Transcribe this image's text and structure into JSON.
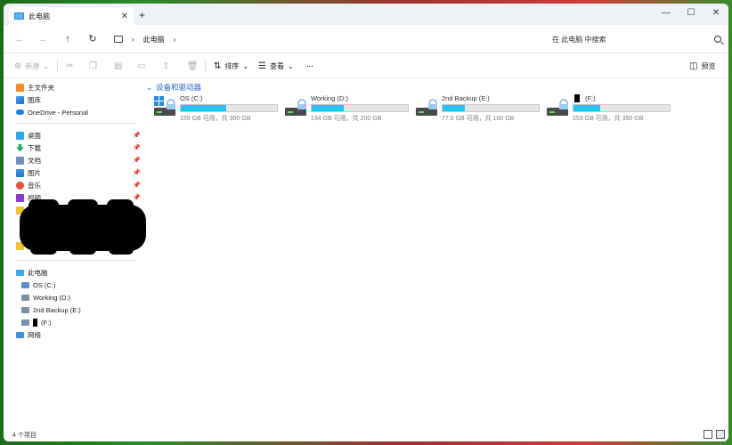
{
  "window": {
    "tab_title": "此电脑",
    "tab_close": "✕",
    "new_tab": "+",
    "minimize": "—",
    "maximize": "☐",
    "close": "✕"
  },
  "address": {
    "back": "←",
    "forward": "→",
    "up": "↑",
    "refresh": "↻",
    "crumb_sep": "›",
    "breadcrumb": [
      "此电脑"
    ],
    "search_placeholder": "在 此电脑 中搜索"
  },
  "toolbar": {
    "new_label": "新建",
    "sort_label": "排序",
    "view_label": "查看",
    "more_label": "···",
    "preview_label": "预览"
  },
  "sidebar": {
    "top_items": [
      {
        "label": "主文件夹",
        "icon": "home-icon"
      },
      {
        "label": "图库",
        "icon": "gallery-icon"
      },
      {
        "label": "OneDrive - Personal",
        "icon": "cloud-icon"
      }
    ],
    "quick_items": [
      {
        "label": "桌面",
        "icon": "desktop-icon"
      },
      {
        "label": "下载",
        "icon": "download-icon"
      },
      {
        "label": "文档",
        "icon": "document-icon"
      },
      {
        "label": "图片",
        "icon": "picture-icon"
      },
      {
        "label": "音乐",
        "icon": "music-icon"
      },
      {
        "label": "视频",
        "icon": "video-icon"
      }
    ],
    "this_pc": "此电脑",
    "drives": [
      "OS (C:)",
      "Working (D:)",
      "2nd Backup (E:)",
      "(F:)"
    ],
    "network": "网络"
  },
  "content": {
    "section_title": "设备和驱动器",
    "drives": [
      {
        "name": "OS (C:)",
        "free_text": "159 GB 可用，共 300 GB",
        "used_fraction": 0.47
      },
      {
        "name": "Working (D:)",
        "free_text": "134 GB 可用，共 200 GB",
        "used_fraction": 0.33
      },
      {
        "name": "2nd Backup (E:)",
        "free_text": "77.0 GB 可用，共 100 GB",
        "used_fraction": 0.23
      },
      {
        "name": "(F:)",
        "free_text": "253 GB 可用，共 350 GB",
        "used_fraction": 0.28
      }
    ]
  },
  "status": {
    "item_count": "4 个项目"
  },
  "colors": {
    "accent": "#26c3f2",
    "link": "#2a62c9"
  }
}
